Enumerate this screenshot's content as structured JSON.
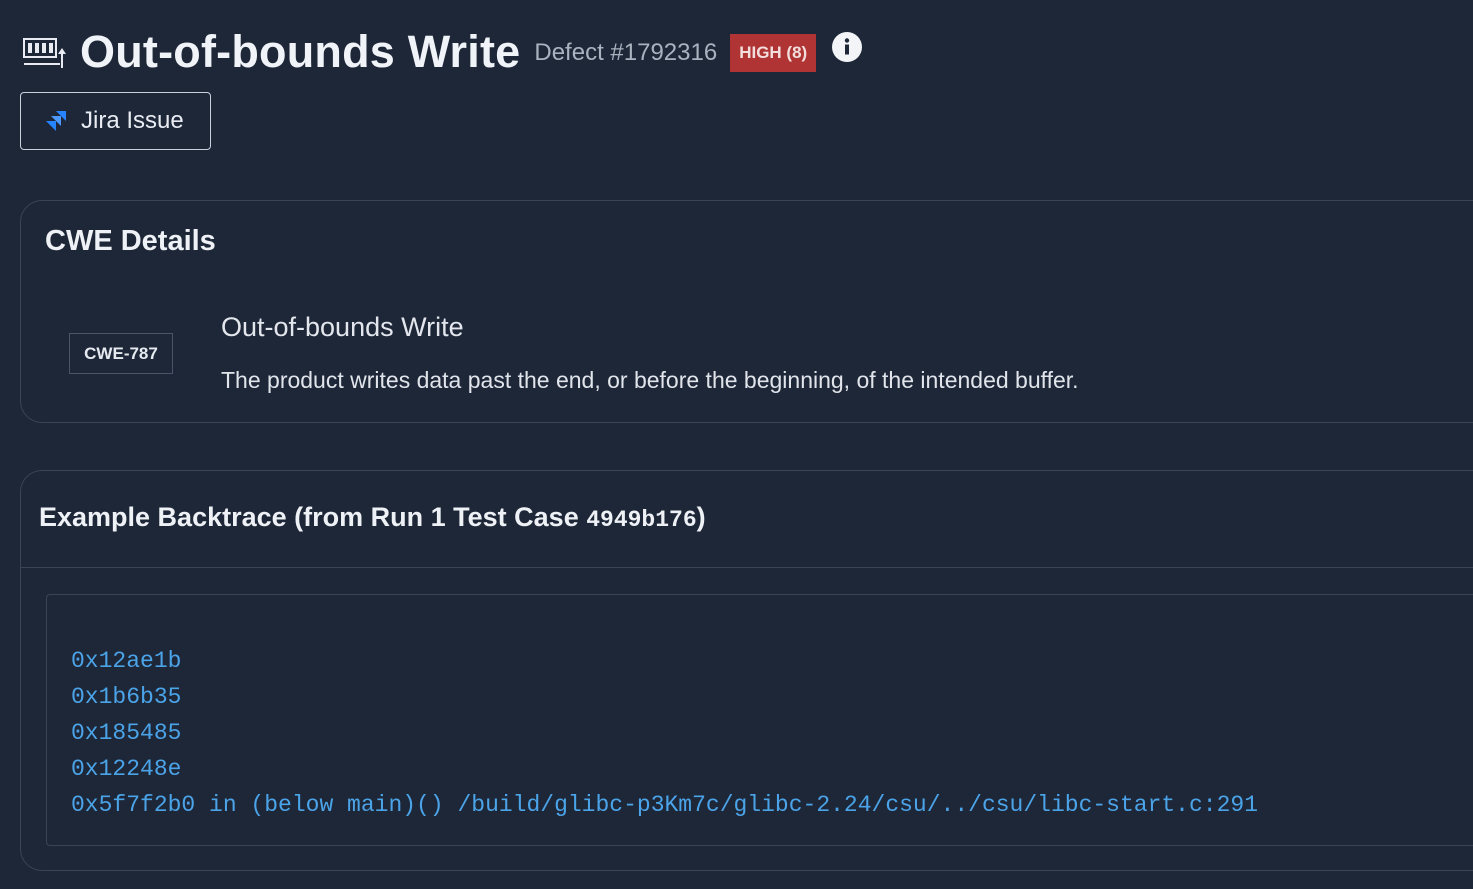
{
  "header": {
    "title": "Out-of-bounds Write",
    "defect_id": "Defect #1792316",
    "severity": "HIGH (8)",
    "icons": {
      "defect": "memory-write-icon",
      "info": "info-icon"
    },
    "colors": {
      "severity_bg": "#b03434",
      "background": "#1e2738"
    }
  },
  "jira_button": {
    "label": "Jira Issue",
    "icon": "jira-icon",
    "icon_color": "#2684ff"
  },
  "cwe_card": {
    "heading": "CWE Details",
    "badge": "CWE-787",
    "name": "Out-of-bounds Write",
    "description": "The product writes data past the end, or before the beginning, of the intended buffer."
  },
  "backtrace_card": {
    "heading_prefix": "Example Backtrace (from Run 1 Test Case ",
    "test_case": "4949b176",
    "heading_suffix": ")",
    "lines": [
      "0x12ae1b",
      "0x1b6b35",
      "0x185485",
      "0x12248e",
      "0x5f7f2b0 in (below main)() /build/glibc-p3Km7c/glibc-2.24/csu/../csu/libc-start.c:291"
    ],
    "code_color": "#4ba3e8"
  }
}
